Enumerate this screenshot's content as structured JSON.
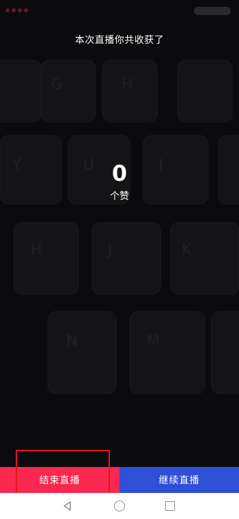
{
  "summary": {
    "title": "本次直播你共收获了",
    "like_count": "0",
    "like_unit": "个赞"
  },
  "buttons": {
    "end_live": "结束直播",
    "continue_live": "继续直播"
  },
  "colors": {
    "background": "#0b0b0e",
    "end_button": "#f8284e",
    "continue_button": "#2f4fd6",
    "highlight_box": "#e3161e"
  },
  "nav": {
    "back_icon": "triangle-back-icon",
    "home_icon": "circle-home-icon",
    "recent_icon": "square-recent-icon"
  },
  "backdrop_keys": [
    "G",
    "H",
    "Y",
    "U",
    "I",
    "H",
    "J",
    "K",
    "N",
    "M"
  ]
}
